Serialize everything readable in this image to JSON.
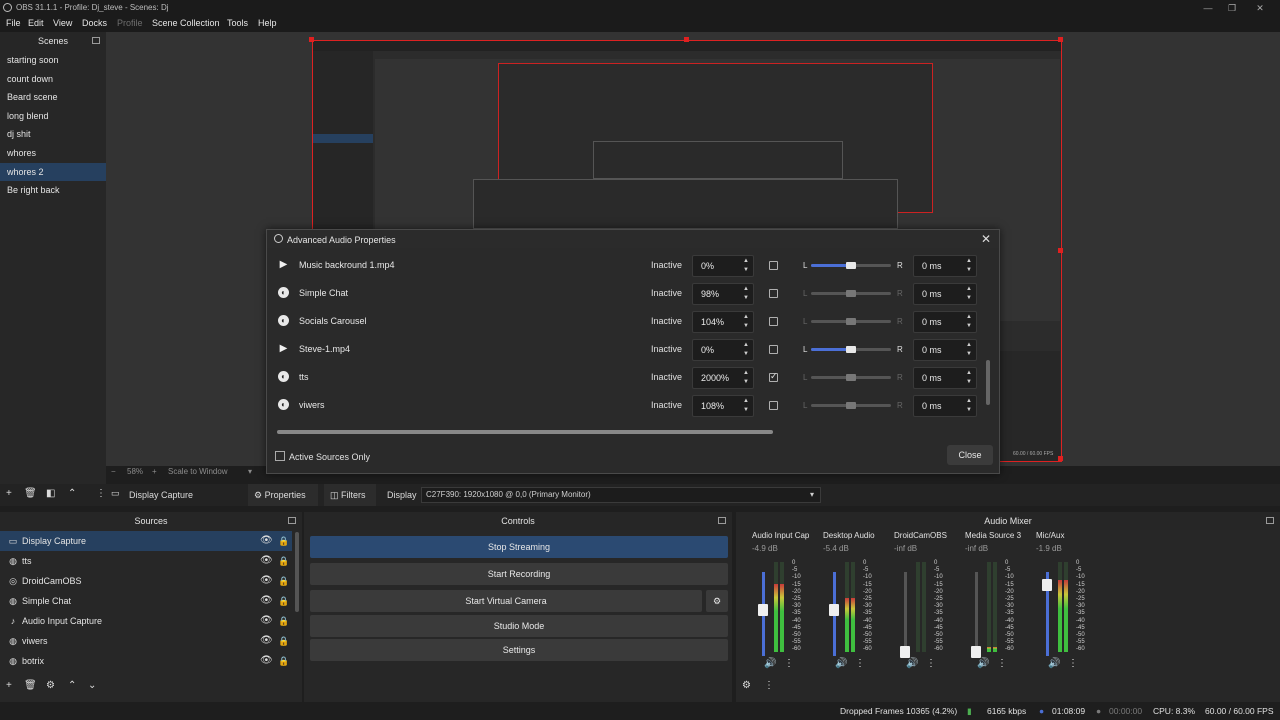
{
  "window": {
    "title": "OBS 31.1.1 - Profile: Dj_steve - Scenes: Dj",
    "buttons": [
      "—",
      "❐",
      "✕"
    ]
  },
  "menu": [
    "File",
    "Edit",
    "View",
    "Docks",
    "Profile",
    "Scene Collection",
    "Tools",
    "Help"
  ],
  "scenes": {
    "header": "Scenes",
    "items": [
      "starting soon",
      "count down",
      "Beard scene",
      "long blend",
      "dj shit",
      "whores",
      "whores 2",
      "Be right back"
    ],
    "selected": "whores 2"
  },
  "preview": {
    "zoom": "58%",
    "scale_mode": "Scale to Window",
    "nested_fps": "60.00 / 60.00 FPS"
  },
  "dialog": {
    "title": "Advanced Audio Properties",
    "rows": [
      {
        "name": "Music backround 1.mp4",
        "icon": "play-icon",
        "status": "Inactive",
        "volume": "0%",
        "mono": false,
        "balance_active": true,
        "balance": 0.5,
        "sync": "0 ms"
      },
      {
        "name": "Simple Chat",
        "icon": "browser-icon",
        "status": "Inactive",
        "volume": "98%",
        "mono": false,
        "balance_active": false,
        "balance": 0.5,
        "sync": "0 ms"
      },
      {
        "name": "Socials Carousel",
        "icon": "browser-icon",
        "status": "Inactive",
        "volume": "104%",
        "mono": false,
        "balance_active": false,
        "balance": 0.5,
        "sync": "0 ms"
      },
      {
        "name": "Steve-1.mp4",
        "icon": "play-icon",
        "status": "Inactive",
        "volume": "0%",
        "mono": false,
        "balance_active": true,
        "balance": 0.5,
        "sync": "0 ms"
      },
      {
        "name": "tts",
        "icon": "browser-icon",
        "status": "Inactive",
        "volume": "2000%",
        "mono": true,
        "balance_active": false,
        "balance": 0.5,
        "sync": "0 ms"
      },
      {
        "name": "viwers",
        "icon": "browser-icon",
        "status": "Inactive",
        "volume": "108%",
        "mono": false,
        "balance_active": false,
        "balance": 0.5,
        "sync": "0 ms"
      }
    ],
    "balance_left": "L",
    "balance_right": "R",
    "filter_label": "Active Sources Only",
    "close_label": "Close"
  },
  "source_toolbar": {
    "selected_source": "Display Capture",
    "properties_label": "Properties",
    "filters_label": "Filters",
    "display_label": "Display",
    "display_value": "C27F390: 1920x1080 @ 0,0 (Primary Monitor)"
  },
  "sources": {
    "header": "Sources",
    "items": [
      {
        "name": "Display Capture",
        "icon": "monitor-icon"
      },
      {
        "name": "tts",
        "icon": "globe-icon"
      },
      {
        "name": "DroidCamOBS",
        "icon": "camera-icon"
      },
      {
        "name": "Simple Chat",
        "icon": "globe-icon"
      },
      {
        "name": "Audio Input Capture",
        "icon": "microphone-icon"
      },
      {
        "name": "viwers",
        "icon": "globe-icon"
      },
      {
        "name": "botrix",
        "icon": "globe-icon"
      }
    ],
    "selected": "Display Capture"
  },
  "controls": {
    "header": "Controls",
    "buttons": [
      "Stop Streaming",
      "Start Recording",
      "Start Virtual Camera",
      "Studio Mode",
      "Settings"
    ]
  },
  "mixer": {
    "header": "Audio Mixer",
    "channels": [
      {
        "name": "Audio Input Cap",
        "db": "-4.9 dB",
        "muted": false,
        "level": 0.75,
        "volume": 0.55
      },
      {
        "name": "Desktop Audio",
        "db": "-5.4 dB",
        "muted": false,
        "level": 0.6,
        "volume": 0.55
      },
      {
        "name": "DroidCamOBS",
        "db": "-inf dB",
        "muted": true,
        "level": 0,
        "volume": 0.05
      },
      {
        "name": "Media Source 3",
        "db": "-inf dB",
        "muted": true,
        "level": 0.05,
        "volume": 0.05
      },
      {
        "name": "Mic/Aux",
        "db": "-1.9 dB",
        "muted": false,
        "level": 0.8,
        "volume": 0.85
      }
    ],
    "scale": [
      "0",
      "-5",
      "-10",
      "-15",
      "-20",
      "-25",
      "-30",
      "-35",
      "-40",
      "-45",
      "-50",
      "-55",
      "-60"
    ]
  },
  "status": {
    "dropped_frames": "Dropped Frames 10365 (4.2%)",
    "bitrate": "6165 kbps",
    "stream_time": "01:08:09",
    "record_time": "00:00:00",
    "cpu": "CPU: 8.3%",
    "fps": "60.00 / 60.00 FPS"
  },
  "colors": {
    "accent": "#4b6fd6",
    "selection": "#26405f",
    "red_outline": "#dd2222"
  }
}
